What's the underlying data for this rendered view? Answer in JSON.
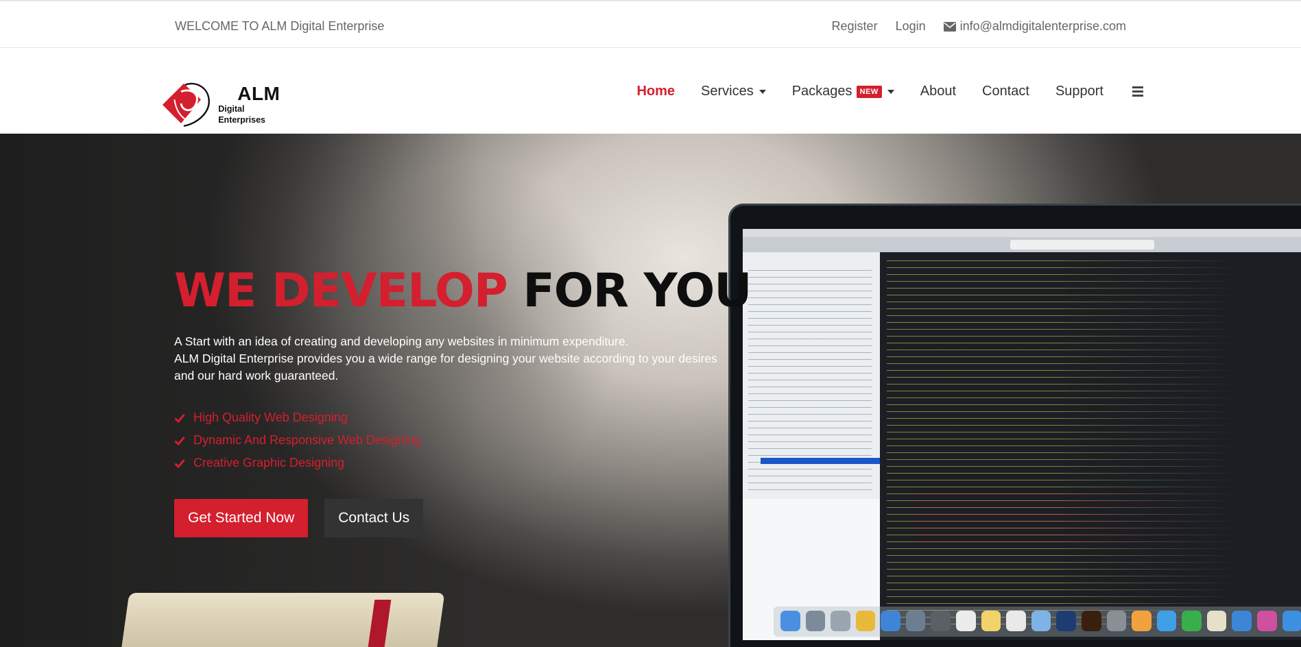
{
  "topbar": {
    "welcome": "WELCOME TO ALM Digital Enterprise",
    "register": "Register",
    "login": "Login",
    "email": "info@almdigitalenterprise.com"
  },
  "logo": {
    "name": "ALM",
    "tagline": "Digital Enterprises"
  },
  "nav": {
    "home": "Home",
    "services": "Services",
    "packages": "Packages",
    "packages_badge": "NEW",
    "about": "About",
    "contact": "Contact",
    "support": "Support"
  },
  "hero": {
    "title_red": "WE DEVELOP",
    "title_black": "FOR YOU",
    "desc_line1": "A Start with an idea of creating and developing any websites in minimum expenditure.",
    "desc_line2": "ALM Digital Enterprise provides you a wide range for designing your website according to your desires and our hard work guaranteed.",
    "features": [
      "High Quality Web Designing",
      "Dynamic And Responsive Web Designing",
      "Creative Graphic Designing"
    ],
    "primary_button": "Get Started Now",
    "secondary_button": "Contact Us"
  },
  "colors": {
    "accent": "#d41f2e",
    "dark_button": "#333333"
  },
  "icons": [
    "envelope-icon",
    "caret-down-icon",
    "hamburger-menu-icon",
    "check-icon",
    "logo-mark-icon"
  ]
}
